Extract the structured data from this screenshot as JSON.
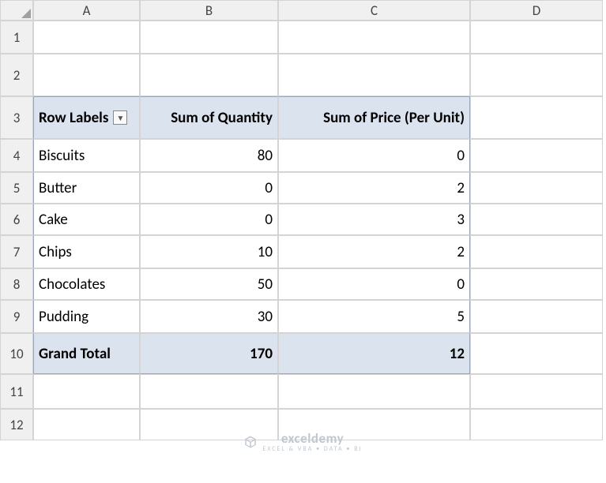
{
  "columns": [
    "A",
    "B",
    "C",
    "D"
  ],
  "rowNumbers": [
    "1",
    "2",
    "3",
    "4",
    "5",
    "6",
    "7",
    "8",
    "9",
    "10",
    "11",
    "12"
  ],
  "pivot": {
    "header": {
      "rowLabels": "Row Labels",
      "col1": "Sum of Quantity",
      "col2": "Sum of Price (Per Unit)"
    },
    "rows": [
      {
        "label": "Biscuits",
        "qty": "80",
        "price": "0"
      },
      {
        "label": "Butter",
        "qty": "0",
        "price": "2"
      },
      {
        "label": "Cake",
        "qty": "0",
        "price": "3"
      },
      {
        "label": "Chips",
        "qty": "10",
        "price": "2"
      },
      {
        "label": "Chocolates",
        "qty": "50",
        "price": "0"
      },
      {
        "label": "Pudding",
        "qty": "30",
        "price": "5"
      }
    ],
    "total": {
      "label": "Grand Total",
      "qty": "170",
      "price": "12"
    }
  },
  "watermark": {
    "brand": "exceldemy",
    "tagline": "EXCEL & VBA • DATA • BI"
  }
}
